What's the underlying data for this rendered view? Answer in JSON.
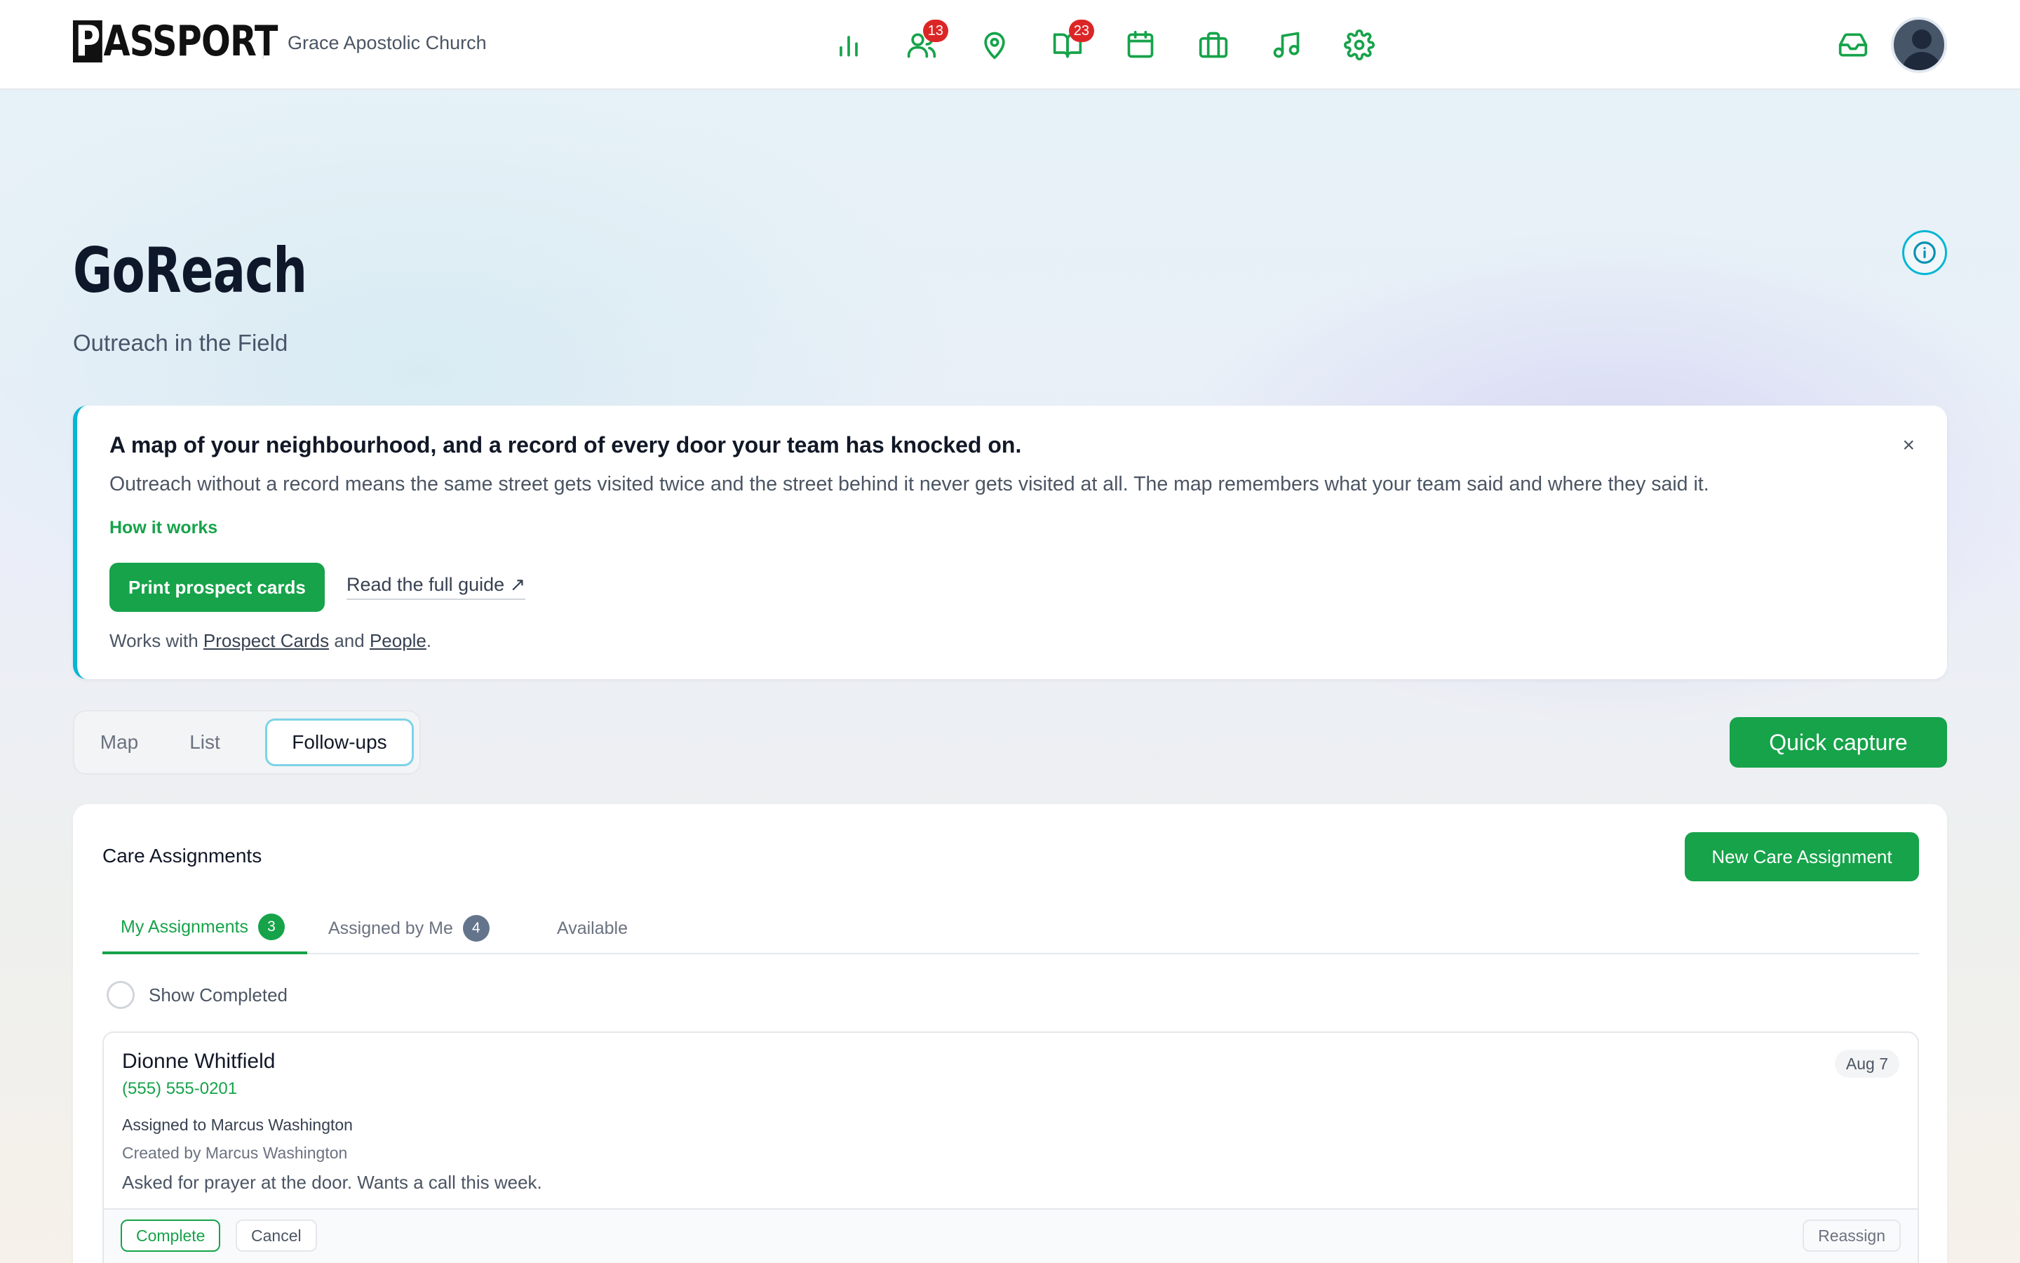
{
  "brand": {
    "logo_text": "PASSPORT",
    "org_name": "Grace Apostolic Church"
  },
  "nav": {
    "icons": [
      {
        "name": "bar-chart-icon",
        "badge": null
      },
      {
        "name": "users-icon",
        "badge": "13"
      },
      {
        "name": "map-pin-icon",
        "badge": null
      },
      {
        "name": "book-open-icon",
        "badge": "23"
      },
      {
        "name": "calendar-icon",
        "badge": null
      },
      {
        "name": "briefcase-icon",
        "badge": null
      },
      {
        "name": "music-icon",
        "badge": null
      },
      {
        "name": "gear-icon",
        "badge": null
      }
    ],
    "inbox_icon": "inbox-icon",
    "avatar_icon": "user-avatar-icon"
  },
  "header": {
    "title": "GoReach",
    "subtitle": "Outreach in the Field",
    "info_icon": "info-icon"
  },
  "intro": {
    "heading": "A map of your neighbourhood, and a record of every door your team has knocked on.",
    "close_label": "×",
    "body": "Outreach without a record means the same street gets visited twice and the street behind it never gets visited at all. The map remembers what your team said and where they said it.",
    "how_it_works": "How it works",
    "print_button": "Print prospect cards",
    "guide_link": "Read the full guide ↗",
    "works_with_prefix": "Works with",
    "works_with_link1": "Prospect Cards",
    "works_with_and": "and",
    "works_with_link2": "People",
    "works_with_suffix": "."
  },
  "view_tabs": {
    "map": "Map",
    "list": "List",
    "follow_ups": "Follow-ups",
    "active": "follow_ups"
  },
  "quick_capture": "Quick capture",
  "care": {
    "title": "Care Assignments",
    "new_button": "New Care Assignment",
    "tabs": {
      "mine": {
        "label": "My Assignments",
        "count": "3"
      },
      "by_me": {
        "label": "Assigned by Me",
        "count": "4"
      },
      "available": {
        "label": "Available"
      }
    },
    "show_completed": "Show Completed",
    "assignment": {
      "name": "Dionne Whitfield",
      "phone": "(555) 555-0201",
      "date": "Aug 7",
      "assigned_to": "Assigned to Marcus Washington",
      "created_by": "Created by Marcus Washington",
      "note": "Asked for prayer at the door. Wants a call this week.",
      "complete": "Complete",
      "cancel": "Cancel",
      "reassign": "Reassign"
    }
  },
  "colors": {
    "accent": "#16a34a",
    "info": "#06b6d4",
    "badge": "#dc2626"
  }
}
